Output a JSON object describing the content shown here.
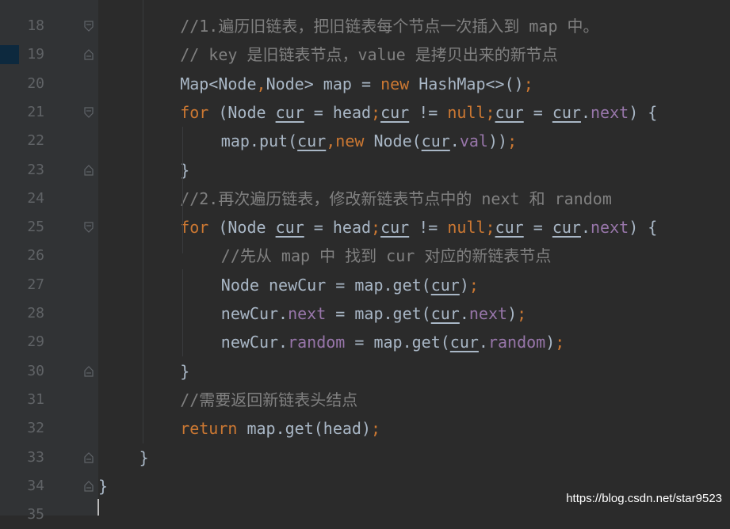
{
  "editor": {
    "line_numbers": [
      "18",
      "19",
      "20",
      "21",
      "22",
      "23",
      "24",
      "25",
      "26",
      "27",
      "28",
      "29",
      "30",
      "31",
      "32",
      "33",
      "34",
      "35"
    ],
    "lines": [
      {
        "n": "18",
        "indent": 8,
        "fold": "open",
        "tokens": [
          {
            "t": "//1.遍历旧链表，把旧链表每个节点一次插入到 map 中。",
            "k": "comment"
          }
        ]
      },
      {
        "n": "19",
        "indent": 8,
        "fold": "end",
        "tokens": [
          {
            "t": "// key 是旧链表节点，value 是拷贝出来的新节点",
            "k": "comment"
          }
        ]
      },
      {
        "n": "20",
        "indent": 8,
        "fold": "",
        "tokens": [
          {
            "t": "Map<Node",
            "k": "plain"
          },
          {
            "t": ",",
            "k": "punct"
          },
          {
            "t": "Node> map = ",
            "k": "plain"
          },
          {
            "t": "new",
            "k": "keyword"
          },
          {
            "t": " HashMap<>()",
            "k": "plain"
          },
          {
            "t": ";",
            "k": "punct"
          }
        ]
      },
      {
        "n": "21",
        "indent": 8,
        "fold": "open",
        "tokens": [
          {
            "t": "for",
            "k": "keyword"
          },
          {
            "t": " (Node ",
            "k": "plain"
          },
          {
            "t": "cur",
            "k": "var"
          },
          {
            "t": " = head",
            "k": "plain"
          },
          {
            "t": ";",
            "k": "punct"
          },
          {
            "t": "cur",
            "k": "var"
          },
          {
            "t": " != ",
            "k": "plain"
          },
          {
            "t": "null",
            "k": "keyword"
          },
          {
            "t": ";",
            "k": "punct"
          },
          {
            "t": "cur",
            "k": "var"
          },
          {
            "t": " = ",
            "k": "plain"
          },
          {
            "t": "cur",
            "k": "var"
          },
          {
            "t": ".",
            "k": "plain"
          },
          {
            "t": "next",
            "k": "field"
          },
          {
            "t": ") {",
            "k": "plain"
          }
        ]
      },
      {
        "n": "22",
        "indent": 12,
        "fold": "",
        "tokens": [
          {
            "t": "map.put(",
            "k": "plain"
          },
          {
            "t": "cur",
            "k": "var"
          },
          {
            "t": ",",
            "k": "punct"
          },
          {
            "t": "new",
            "k": "keyword"
          },
          {
            "t": " Node(",
            "k": "plain"
          },
          {
            "t": "cur",
            "k": "var"
          },
          {
            "t": ".",
            "k": "plain"
          },
          {
            "t": "val",
            "k": "field"
          },
          {
            "t": "))",
            "k": "plain"
          },
          {
            "t": ";",
            "k": "punct"
          }
        ]
      },
      {
        "n": "23",
        "indent": 8,
        "fold": "end",
        "tokens": [
          {
            "t": "}",
            "k": "plain"
          }
        ]
      },
      {
        "n": "24",
        "indent": 8,
        "fold": "",
        "tokens": [
          {
            "t": "//2.再次遍历链表，修改新链表节点中的 next 和 random",
            "k": "comment"
          }
        ]
      },
      {
        "n": "25",
        "indent": 8,
        "fold": "open",
        "tokens": [
          {
            "t": "for",
            "k": "keyword"
          },
          {
            "t": " (Node ",
            "k": "plain"
          },
          {
            "t": "cur",
            "k": "var"
          },
          {
            "t": " = head",
            "k": "plain"
          },
          {
            "t": ";",
            "k": "punct"
          },
          {
            "t": "cur",
            "k": "var"
          },
          {
            "t": " != ",
            "k": "plain"
          },
          {
            "t": "null",
            "k": "keyword"
          },
          {
            "t": ";",
            "k": "punct"
          },
          {
            "t": "cur",
            "k": "var"
          },
          {
            "t": " = ",
            "k": "plain"
          },
          {
            "t": "cur",
            "k": "var"
          },
          {
            "t": ".",
            "k": "plain"
          },
          {
            "t": "next",
            "k": "field"
          },
          {
            "t": ") {",
            "k": "plain"
          }
        ]
      },
      {
        "n": "26",
        "indent": 12,
        "fold": "",
        "tokens": [
          {
            "t": "//先从 map 中 找到 cur 对应的新链表节点",
            "k": "comment"
          }
        ]
      },
      {
        "n": "27",
        "indent": 12,
        "fold": "",
        "tokens": [
          {
            "t": "Node newCur = map.get(",
            "k": "plain"
          },
          {
            "t": "cur",
            "k": "var"
          },
          {
            "t": ")",
            "k": "plain"
          },
          {
            "t": ";",
            "k": "punct"
          }
        ]
      },
      {
        "n": "28",
        "indent": 12,
        "fold": "",
        "tokens": [
          {
            "t": "newCur.",
            "k": "plain"
          },
          {
            "t": "next",
            "k": "field"
          },
          {
            "t": " = map.get(",
            "k": "plain"
          },
          {
            "t": "cur",
            "k": "var"
          },
          {
            "t": ".",
            "k": "plain"
          },
          {
            "t": "next",
            "k": "field"
          },
          {
            "t": ")",
            "k": "plain"
          },
          {
            "t": ";",
            "k": "punct"
          }
        ]
      },
      {
        "n": "29",
        "indent": 12,
        "fold": "",
        "tokens": [
          {
            "t": "newCur.",
            "k": "plain"
          },
          {
            "t": "random",
            "k": "field"
          },
          {
            "t": " = map.get(",
            "k": "plain"
          },
          {
            "t": "cur",
            "k": "var"
          },
          {
            "t": ".",
            "k": "plain"
          },
          {
            "t": "random",
            "k": "field"
          },
          {
            "t": ")",
            "k": "plain"
          },
          {
            "t": ";",
            "k": "punct"
          }
        ]
      },
      {
        "n": "30",
        "indent": 8,
        "fold": "end",
        "tokens": [
          {
            "t": "}",
            "k": "plain"
          }
        ]
      },
      {
        "n": "31",
        "indent": 8,
        "fold": "",
        "tokens": [
          {
            "t": "//需要返回新链表头结点",
            "k": "comment"
          }
        ]
      },
      {
        "n": "32",
        "indent": 8,
        "fold": "",
        "tokens": [
          {
            "t": "return",
            "k": "keyword"
          },
          {
            "t": " map.get(head)",
            "k": "plain"
          },
          {
            "t": ";",
            "k": "punct"
          }
        ]
      },
      {
        "n": "33",
        "indent": 4,
        "fold": "end",
        "tokens": [
          {
            "t": "}",
            "k": "plain"
          }
        ]
      },
      {
        "n": "34",
        "indent": 0,
        "fold": "end",
        "tokens": [
          {
            "t": "}",
            "k": "plain"
          }
        ]
      },
      {
        "n": "35",
        "indent": 0,
        "fold": "",
        "tokens": []
      }
    ]
  },
  "colors": {
    "background": "#2b2b2b",
    "gutter": "#313335",
    "comment": "#808080",
    "keyword": "#cc7832",
    "field": "#9876aa",
    "text": "#a9b7c6"
  },
  "watermark": "https://blog.csdn.net/star9523"
}
